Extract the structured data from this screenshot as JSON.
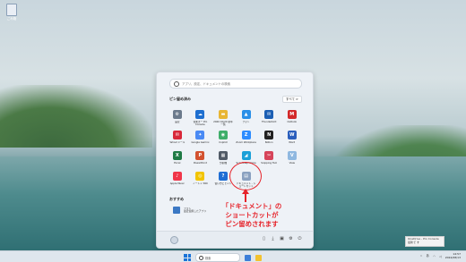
{
  "desktop": {
    "icon_label": "ごみ箱"
  },
  "start_menu": {
    "search_placeholder": "アプリ、設定、ドキュメントの検索",
    "pinned_title": "ピン留め済み",
    "all_button": "すべて >",
    "apps": [
      {
        "label": "設定",
        "icon": "settings-icon",
        "color": "#6b7a8c",
        "glyph": "⚙"
      },
      {
        "label": "音楽まー Pro Console",
        "icon": "onedrive-icon",
        "color": "#1e6fd0",
        "glyph": "☁"
      },
      {
        "label": "2020 10/20 新年一覧",
        "icon": "folder-icon",
        "color": "#e8b634",
        "glyph": "▬"
      },
      {
        "label": "フォト",
        "icon": "photos-icon",
        "color": "#2a8fe8",
        "glyph": "▲"
      },
      {
        "label": "Thunderbird",
        "icon": "thunderbird-icon",
        "color": "#1c5fb4",
        "glyph": "✉"
      },
      {
        "label": "Outlook",
        "icon": "outlook-icon",
        "color": "#d3292a",
        "glyph": "M"
      },
      {
        "label": "Yahoo!メール",
        "icon": "mail-icon",
        "color": "#d8283a",
        "glyph": "✉"
      },
      {
        "label": "Google Gemini",
        "icon": "gemini-icon",
        "color": "#4a8af4",
        "glyph": "✦"
      },
      {
        "label": "Copilot",
        "icon": "copilot-icon",
        "color": "#3fae6a",
        "glyph": "◉"
      },
      {
        "label": "Zoom Workplace",
        "icon": "zoom-icon",
        "color": "#2d8cff",
        "glyph": "Z"
      },
      {
        "label": "Notion",
        "icon": "notion-icon",
        "color": "#222222",
        "glyph": "N"
      },
      {
        "label": "Word",
        "icon": "word-icon",
        "color": "#2b5fbd",
        "glyph": "W"
      },
      {
        "label": "Excel",
        "icon": "excel-icon",
        "color": "#1f7a45",
        "glyph": "X"
      },
      {
        "label": "PowerPoint",
        "icon": "powerpoint-icon",
        "color": "#d35230",
        "glyph": "P"
      },
      {
        "label": "分析機",
        "icon": "calculator-icon",
        "color": "#505a66",
        "glyph": "▦"
      },
      {
        "label": "ScanSnap Home",
        "icon": "scansnap-icon",
        "color": "#1aa0d8",
        "glyph": "◢"
      },
      {
        "label": "Snipping Tool",
        "icon": "snipping-icon",
        "color": "#d6445a",
        "glyph": "✂"
      },
      {
        "label": "View",
        "icon": "view-icon",
        "color": "#8fb8e0",
        "glyph": "V"
      },
      {
        "label": "Apple Music",
        "icon": "music-icon",
        "color": "#f0364a",
        "glyph": "♪"
      },
      {
        "label": "ノートン 360",
        "icon": "norton-icon",
        "color": "#f2c400",
        "glyph": "◎"
      },
      {
        "label": "使い方とヒント",
        "icon": "help-icon",
        "color": "#1f6ed4",
        "glyph": "?"
      },
      {
        "label": "ドキュメント - ショートカット",
        "icon": "document-shortcut-icon",
        "color": "#8aa1c0",
        "glyph": "▤"
      }
    ],
    "recommended_title": "おすすめ",
    "recommended_item_title": "フォト",
    "recommended_item_sub": "最近使用したアプリ"
  },
  "annotation": {
    "line1": "「ドキュメント」の",
    "line2": "ショートカットが",
    "line3": "ピン留めされます"
  },
  "toast": {
    "text": "OneDrive - Pro Console 最新で す"
  },
  "taskbar": {
    "search_label": "検索",
    "time": "14:57",
    "date": "2024/08/13",
    "ime": "あ"
  }
}
